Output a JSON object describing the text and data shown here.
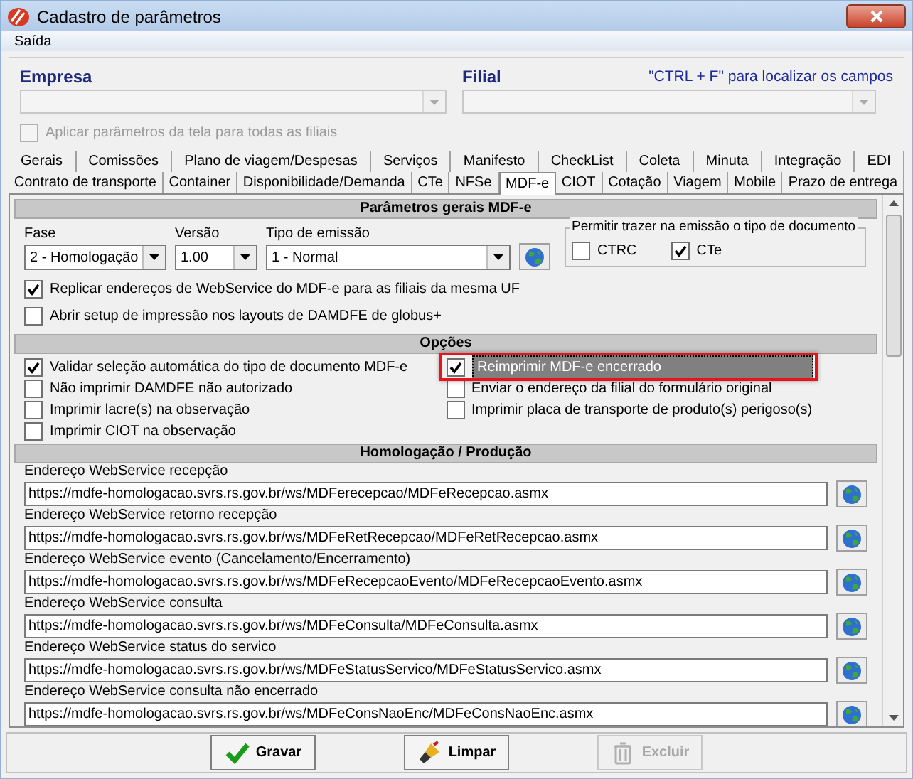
{
  "window": {
    "title": "Cadastro de parâmetros"
  },
  "menu": [
    {
      "label": "Saída"
    }
  ],
  "header": {
    "empresa_label": "Empresa",
    "filial_label": "Filial",
    "hint": "\"CTRL + F\" para localizar os campos",
    "apply_all": {
      "label": "Aplicar parâmetros da tela para todas as filiais",
      "checked": false,
      "disabled": true
    }
  },
  "tab_rows": [
    {
      "tabs": [
        {
          "label": "Gerais",
          "selected": false
        },
        {
          "label": "Comissões",
          "selected": false
        },
        {
          "label": "Plano de viagem/Despesas",
          "selected": false
        },
        {
          "label": "Serviços",
          "selected": false
        },
        {
          "label": "Manifesto",
          "selected": false
        },
        {
          "label": "CheckList",
          "selected": false
        },
        {
          "label": "Coleta",
          "selected": false
        },
        {
          "label": "Minuta",
          "selected": false
        },
        {
          "label": "Integração",
          "selected": false
        },
        {
          "label": "EDI",
          "selected": false
        }
      ]
    },
    {
      "tabs": [
        {
          "label": "Contrato de transporte",
          "selected": false
        },
        {
          "label": "Container",
          "selected": false
        },
        {
          "label": "Disponibilidade/Demanda",
          "selected": false
        },
        {
          "label": "CTe",
          "selected": false
        },
        {
          "label": "NFSe",
          "selected": false
        },
        {
          "label": "MDF-e",
          "selected": true
        },
        {
          "label": "CIOT",
          "selected": false
        },
        {
          "label": "Cotação",
          "selected": false
        },
        {
          "label": "Viagem",
          "selected": false
        },
        {
          "label": "Mobile",
          "selected": false
        },
        {
          "label": "Prazo de entrega",
          "selected": false
        }
      ]
    }
  ],
  "general": {
    "title": "Parâmetros gerais MDF-e",
    "fields": [
      {
        "label": "Fase",
        "value": "2 - Homologação"
      },
      {
        "label": "Versão",
        "value": "1.00"
      },
      {
        "label": "Tipo de emissão",
        "value": "1 - Normal"
      }
    ],
    "doc_types": {
      "title": "Permitir trazer na emissão o tipo de documento",
      "options": [
        {
          "label": "CTRC",
          "checked": false
        },
        {
          "label": "CTe",
          "checked": true
        }
      ]
    },
    "checkboxes": [
      {
        "label": "Replicar endereços de WebService do MDF-e para as filiais da mesma UF",
        "checked": true
      },
      {
        "label": "Abrir setup de impressão nos layouts de DAMDFE de globus+",
        "checked": false
      }
    ]
  },
  "options": {
    "title": "Opções",
    "items": [
      {
        "label": "Validar seleção automática do tipo de documento MDF-e",
        "checked": true,
        "highlighted": false
      },
      {
        "label": "Não imprimir DAMDFE não autorizado",
        "checked": false,
        "highlighted": false
      },
      {
        "label": "Imprimir lacre(s) na observação",
        "checked": false,
        "highlighted": false
      },
      {
        "label": "Imprimir CIOT na observação",
        "checked": false,
        "highlighted": false
      },
      {
        "label": "Reimprimir MDF-e encerrado",
        "checked": true,
        "highlighted": true
      },
      {
        "label": "Enviar o endereço da filial do formulário original",
        "checked": false,
        "highlighted": false
      },
      {
        "label": "Imprimir placa de transporte de produto(s) perigoso(s)",
        "checked": false,
        "highlighted": false
      }
    ]
  },
  "webservices": {
    "title": "Homologação / Produção",
    "items": [
      {
        "label": "Endereço WebService recepção",
        "value": "https://mdfe-homologacao.svrs.rs.gov.br/ws/MDFerecepcao/MDFeRecepcao.asmx"
      },
      {
        "label": "Endereço WebService retorno recepção",
        "value": "https://mdfe-homologacao.svrs.rs.gov.br/ws/MDFeRetRecepcao/MDFeRetRecepcao.asmx"
      },
      {
        "label": "Endereço WebService evento (Cancelamento/Encerramento)",
        "value": "https://mdfe-homologacao.svrs.rs.gov.br/ws/MDFeRecepcaoEvento/MDFeRecepcaoEvento.asmx"
      },
      {
        "label": "Endereço WebService consulta",
        "value": "https://mdfe-homologacao.svrs.rs.gov.br/ws/MDFeConsulta/MDFeConsulta.asmx"
      },
      {
        "label": "Endereço WebService status do servico",
        "value": "https://mdfe-homologacao.svrs.rs.gov.br/ws/MDFeStatusServico/MDFeStatusServico.asmx"
      },
      {
        "label": "Endereço WebService consulta não encerrado",
        "value": "https://mdfe-homologacao.svrs.rs.gov.br/ws/MDFeConsNaoEnc/MDFeConsNaoEnc.asmx"
      }
    ]
  },
  "buttons": [
    {
      "label": "Gravar",
      "kind": "save",
      "disabled": false
    },
    {
      "label": "Limpar",
      "kind": "clear",
      "disabled": false
    },
    {
      "label": "Excluir",
      "kind": "delete",
      "disabled": true
    }
  ]
}
